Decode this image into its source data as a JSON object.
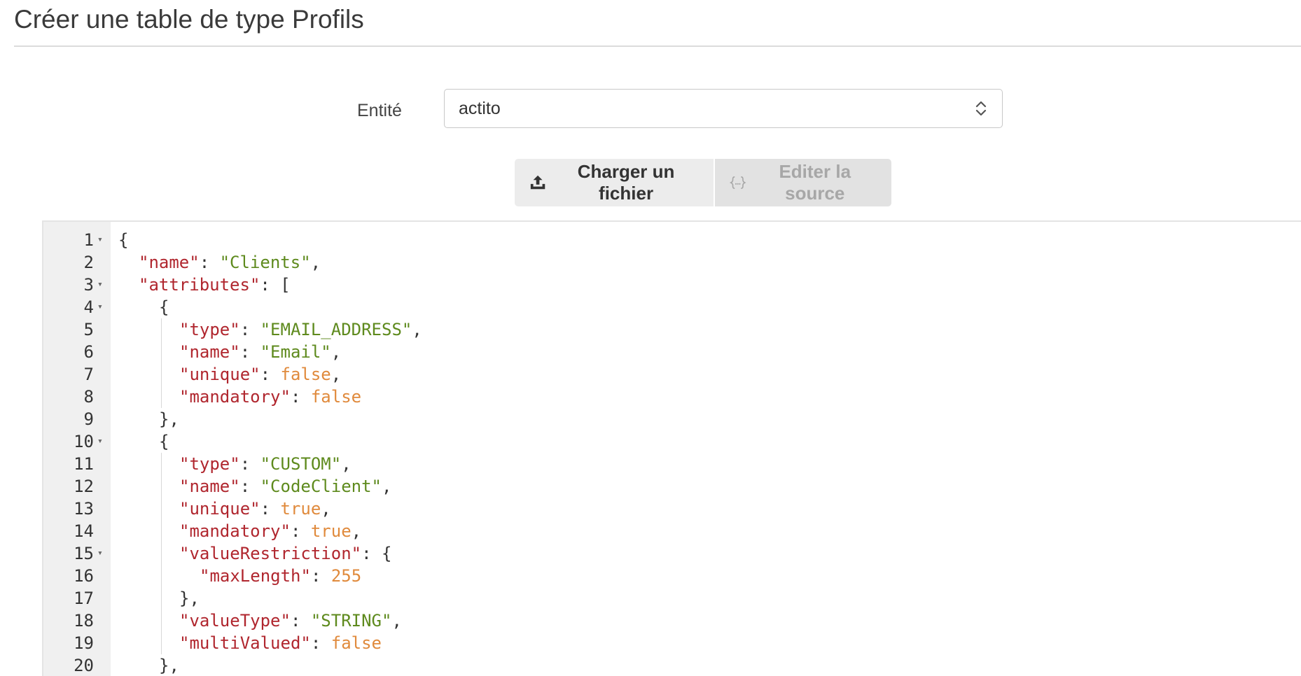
{
  "header": {
    "title": "Créer une table de type Profils"
  },
  "form": {
    "entity_label": "Entité",
    "entity_value": "actito"
  },
  "toolbar": {
    "upload_label": "Charger un fichier",
    "edit_source_label": "Editer la source"
  },
  "editor": {
    "lines": [
      {
        "n": "1",
        "fold": true,
        "indent": 0,
        "tokens": [
          {
            "t": "p",
            "v": "{"
          }
        ]
      },
      {
        "n": "2",
        "fold": false,
        "indent": 1,
        "tokens": [
          {
            "t": "k",
            "v": "\"name\""
          },
          {
            "t": "p",
            "v": ": "
          },
          {
            "t": "s",
            "v": "\"Clients\""
          },
          {
            "t": "p",
            "v": ","
          }
        ]
      },
      {
        "n": "3",
        "fold": true,
        "indent": 1,
        "tokens": [
          {
            "t": "k",
            "v": "\"attributes\""
          },
          {
            "t": "p",
            "v": ": ["
          }
        ]
      },
      {
        "n": "4",
        "fold": true,
        "indent": 2,
        "tokens": [
          {
            "t": "p",
            "v": "{"
          }
        ]
      },
      {
        "n": "5",
        "fold": false,
        "indent": 3,
        "tokens": [
          {
            "t": "k",
            "v": "\"type\""
          },
          {
            "t": "p",
            "v": ": "
          },
          {
            "t": "s",
            "v": "\"EMAIL_ADDRESS\""
          },
          {
            "t": "p",
            "v": ","
          }
        ]
      },
      {
        "n": "6",
        "fold": false,
        "indent": 3,
        "tokens": [
          {
            "t": "k",
            "v": "\"name\""
          },
          {
            "t": "p",
            "v": ": "
          },
          {
            "t": "s",
            "v": "\"Email\""
          },
          {
            "t": "p",
            "v": ","
          }
        ]
      },
      {
        "n": "7",
        "fold": false,
        "indent": 3,
        "tokens": [
          {
            "t": "k",
            "v": "\"unique\""
          },
          {
            "t": "p",
            "v": ": "
          },
          {
            "t": "b",
            "v": "false"
          },
          {
            "t": "p",
            "v": ","
          }
        ]
      },
      {
        "n": "8",
        "fold": false,
        "indent": 3,
        "tokens": [
          {
            "t": "k",
            "v": "\"mandatory\""
          },
          {
            "t": "p",
            "v": ": "
          },
          {
            "t": "b",
            "v": "false"
          }
        ]
      },
      {
        "n": "9",
        "fold": false,
        "indent": 2,
        "tokens": [
          {
            "t": "p",
            "v": "},"
          }
        ]
      },
      {
        "n": "10",
        "fold": true,
        "indent": 2,
        "tokens": [
          {
            "t": "p",
            "v": "{"
          }
        ]
      },
      {
        "n": "11",
        "fold": false,
        "indent": 3,
        "tokens": [
          {
            "t": "k",
            "v": "\"type\""
          },
          {
            "t": "p",
            "v": ": "
          },
          {
            "t": "s",
            "v": "\"CUSTOM\""
          },
          {
            "t": "p",
            "v": ","
          }
        ]
      },
      {
        "n": "12",
        "fold": false,
        "indent": 3,
        "tokens": [
          {
            "t": "k",
            "v": "\"name\""
          },
          {
            "t": "p",
            "v": ": "
          },
          {
            "t": "s",
            "v": "\"CodeClient\""
          },
          {
            "t": "p",
            "v": ","
          }
        ]
      },
      {
        "n": "13",
        "fold": false,
        "indent": 3,
        "tokens": [
          {
            "t": "k",
            "v": "\"unique\""
          },
          {
            "t": "p",
            "v": ": "
          },
          {
            "t": "b",
            "v": "true"
          },
          {
            "t": "p",
            "v": ","
          }
        ]
      },
      {
        "n": "14",
        "fold": false,
        "indent": 3,
        "tokens": [
          {
            "t": "k",
            "v": "\"mandatory\""
          },
          {
            "t": "p",
            "v": ": "
          },
          {
            "t": "b",
            "v": "true"
          },
          {
            "t": "p",
            "v": ","
          }
        ]
      },
      {
        "n": "15",
        "fold": true,
        "indent": 3,
        "tokens": [
          {
            "t": "k",
            "v": "\"valueRestriction\""
          },
          {
            "t": "p",
            "v": ": {"
          }
        ]
      },
      {
        "n": "16",
        "fold": false,
        "indent": 4,
        "tokens": [
          {
            "t": "k",
            "v": "\"maxLength\""
          },
          {
            "t": "p",
            "v": ": "
          },
          {
            "t": "b",
            "v": "255"
          }
        ]
      },
      {
        "n": "17",
        "fold": false,
        "indent": 3,
        "tokens": [
          {
            "t": "p",
            "v": "},"
          }
        ]
      },
      {
        "n": "18",
        "fold": false,
        "indent": 3,
        "tokens": [
          {
            "t": "k",
            "v": "\"valueType\""
          },
          {
            "t": "p",
            "v": ": "
          },
          {
            "t": "s",
            "v": "\"STRING\""
          },
          {
            "t": "p",
            "v": ","
          }
        ]
      },
      {
        "n": "19",
        "fold": false,
        "indent": 3,
        "tokens": [
          {
            "t": "k",
            "v": "\"multiValued\""
          },
          {
            "t": "p",
            "v": ": "
          },
          {
            "t": "b",
            "v": "false"
          }
        ]
      },
      {
        "n": "20",
        "fold": false,
        "indent": 2,
        "tokens": [
          {
            "t": "p",
            "v": "},"
          }
        ]
      }
    ]
  },
  "icons": {
    "select_arrows": "chevron-up-down-icon",
    "upload": "upload-icon",
    "edit_source": "code-braces-icon"
  },
  "colors": {
    "key": "#b0262e",
    "string": "#5e8a1d",
    "literal": "#e08a3c",
    "gutter": "#f0f0f0"
  }
}
